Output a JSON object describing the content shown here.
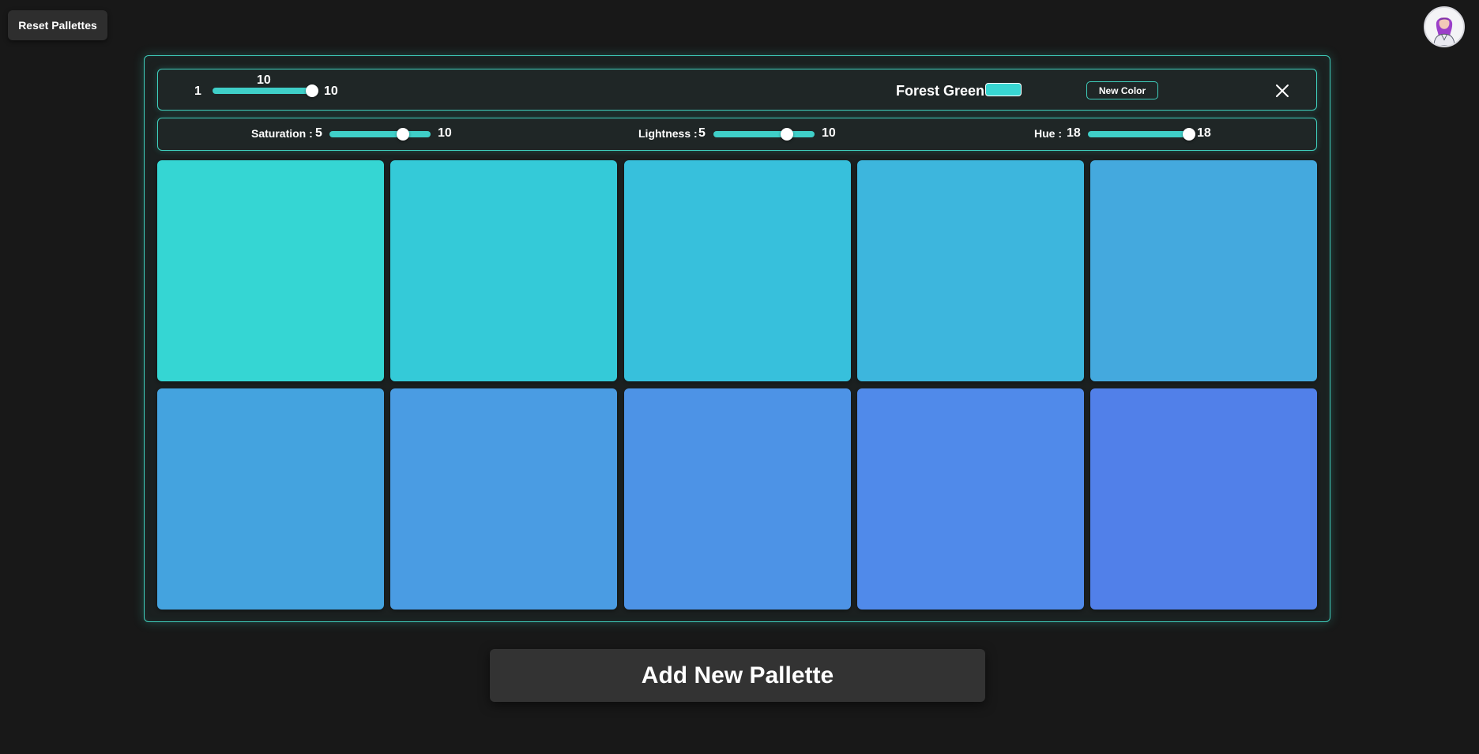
{
  "toolbar": {
    "reset_label": "Reset Pallettes"
  },
  "palette": {
    "count_slider": {
      "min_label": "1",
      "max_label": "10",
      "value_label": "10",
      "min": 1,
      "max": 10,
      "value": 10
    },
    "color_name": "Forest Green:",
    "color_chip": "#38d6d2",
    "new_color_label": "New Color",
    "close_icon": "close-icon",
    "saturation": {
      "label": "Saturation :",
      "min_label": "5",
      "max_label": "10",
      "min": 0,
      "max": 10,
      "value": 7.3
    },
    "lightness": {
      "label": "Lightness :",
      "min_label": "5",
      "max_label": "10",
      "min": 0,
      "max": 10,
      "value": 7.3
    },
    "hue": {
      "label": "Hue :",
      "min_label": "18",
      "max_label": "18",
      "min": 0,
      "max": 18,
      "value": 18
    },
    "colors": [
      "#35d6d3",
      "#34cad8",
      "#37c0dc",
      "#3db6dd",
      "#44a9de",
      "#44a3df",
      "#4a9ce3",
      "#4d93e6",
      "#508aea",
      "#5180e9"
    ]
  },
  "add_label": "Add New Pallette",
  "accent": "#3fcfbd"
}
